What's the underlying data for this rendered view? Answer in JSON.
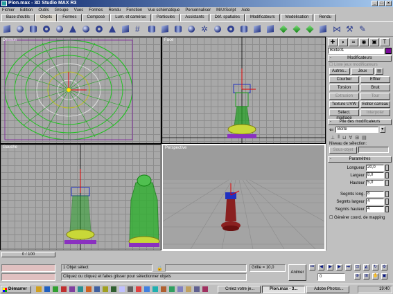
{
  "window": {
    "title": "Pion.max - 3D Studio MAX R3"
  },
  "menu": [
    "Fichier",
    "Edition",
    "Outils",
    "Groupe",
    "Vues",
    "Formes",
    "Rendu",
    "Fonction",
    "Vue schématique",
    "Personnaliser",
    "MAXScript",
    "Aide"
  ],
  "tabs": [
    "Base d'outils",
    "Objets",
    "Formes",
    "Composé",
    "Lum. et caméras",
    "Particules",
    "Assistants",
    "Déf. spatiales",
    "Modificateurs",
    "Modélisation",
    "Rendu"
  ],
  "active_tab": "Objets",
  "viewports": {
    "top": "Dessus",
    "front": "Face",
    "left": "Gauche",
    "perspective": "Perspective"
  },
  "command_panel": {
    "object_name": "Boite01",
    "object_color": "#7a0a9a",
    "modifiers_rollout": "Modificateurs",
    "show_sets_label": "Liste jeux modificateurs",
    "autres_button": "Autres...",
    "sets_button": "Jeux",
    "buttons": [
      {
        "label": "Courber",
        "enabled": true
      },
      {
        "label": "Effiler",
        "enabled": true
      },
      {
        "label": "Torsion",
        "enabled": true
      },
      {
        "label": "Bruit",
        "enabled": true
      },
      {
        "label": "Extrusion",
        "enabled": false
      },
      {
        "label": "Tour",
        "enabled": false
      },
      {
        "label": "Texture UVW",
        "enabled": true
      },
      {
        "label": "Editer carreau",
        "enabled": true
      },
      {
        "label": "Sélect. maillage",
        "enabled": true
      },
      {
        "label": "Interpoler",
        "enabled": false
      }
    ],
    "stack_rollout": "Pile des modificateurs",
    "stack_value": "Boîte",
    "selection_level_label": "Niveau de sélection:",
    "sub_object_button": "Sous-objet",
    "params_rollout": "Paramètres",
    "params": [
      {
        "label": "Longueur",
        "value": "20,0"
      },
      {
        "label": "Largeur",
        "value": "8,0"
      },
      {
        "label": "Hauteur",
        "value": "5,0"
      },
      {
        "label": "Segmts long.",
        "value": "8"
      },
      {
        "label": "Segmts largeur",
        "value": "4"
      },
      {
        "label": "Segmts hauteur",
        "value": "4"
      }
    ],
    "mapping_label": "Générer coord. de mapping"
  },
  "timeline": {
    "position": "0 / 100"
  },
  "status": {
    "selection": "1 Objet sélect",
    "prompt": "Cliquez ou cliquez et faites glisser pour sélectionner objets",
    "grid": "Grille = 10,0",
    "animate_button": "Animer",
    "frame": "0"
  },
  "taskbar": {
    "start": "Démarrer",
    "tasks": [
      "Créez votre je...",
      "Pion.max - 3...",
      "Adobe Photos..."
    ],
    "clock": "19:40"
  }
}
